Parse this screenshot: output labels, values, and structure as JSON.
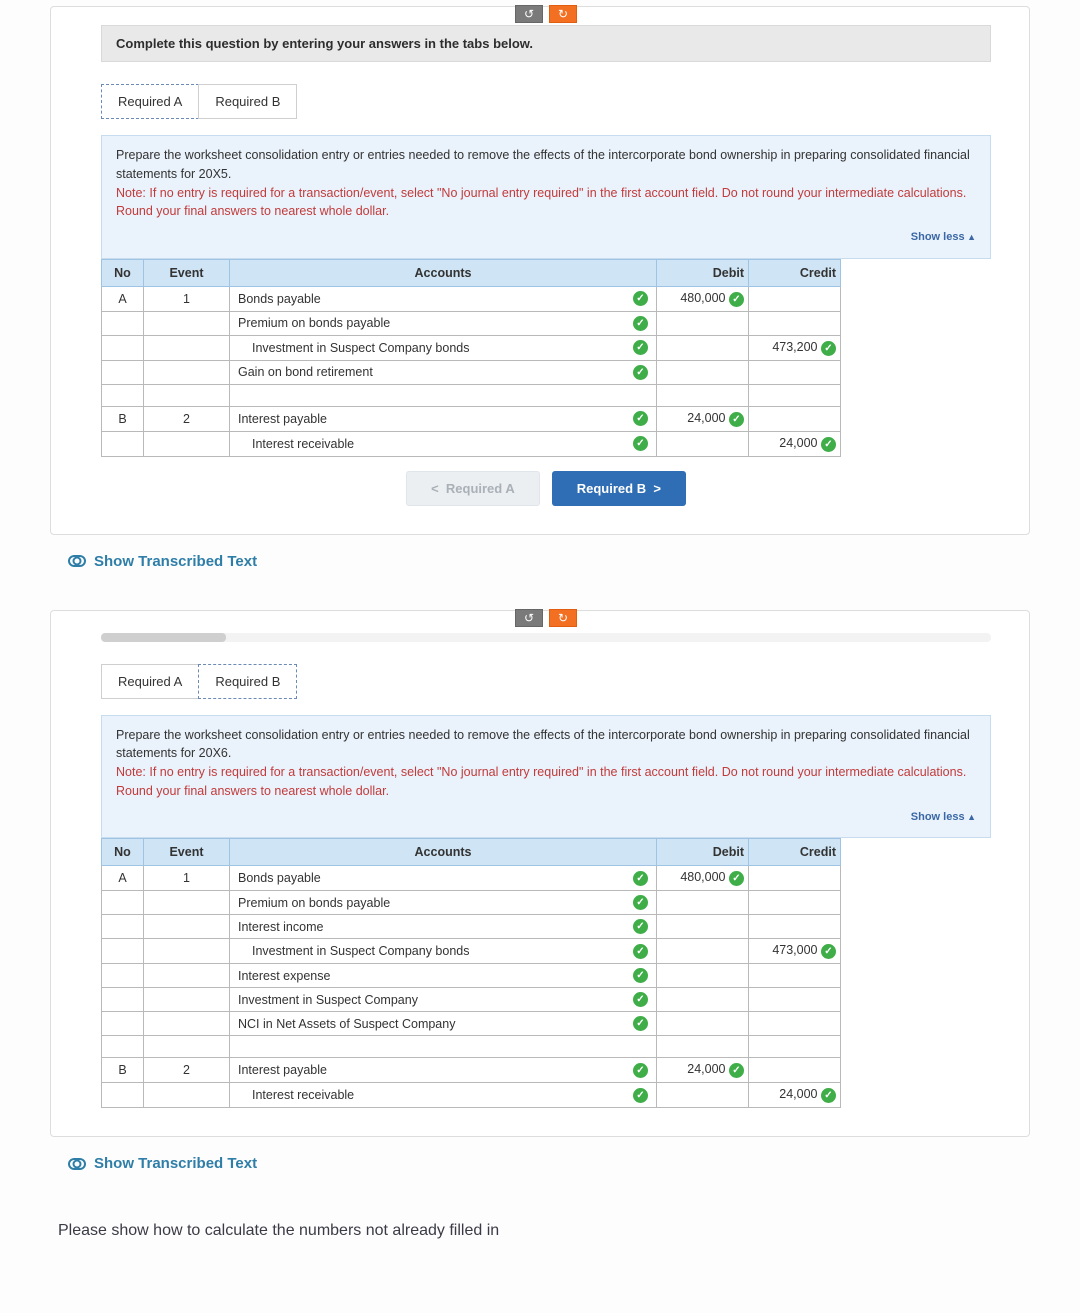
{
  "toolbar": {
    "undo_glyph": "↺",
    "redo_glyph": "↻"
  },
  "instruction": "Complete this question by entering your answers in the tabs below.",
  "tabs": {
    "a": "Required A",
    "b": "Required B"
  },
  "info1": {
    "line1": "Prepare the worksheet consolidation entry or entries needed to remove the effects of the intercorporate bond ownership in preparing consolidated financial statements for 20X5.",
    "note": "Note: If no entry is required for a transaction/event, select \"No journal entry required\" in the first account field. Do not round your intermediate calculations. Round your final answers to nearest whole dollar.",
    "showless": "Show less"
  },
  "info2": {
    "line1": "Prepare the worksheet consolidation entry or entries needed to remove the effects of the intercorporate bond ownership in preparing consolidated financial statements for 20X6.",
    "note": "Note: If no entry is required for a transaction/event, select \"No journal entry required\" in the first account field. Do not round your intermediate calculations. Round your final answers to nearest whole dollar.",
    "showless": "Show less"
  },
  "headers": {
    "no": "No",
    "event": "Event",
    "accounts": "Accounts",
    "debit": "Debit",
    "credit": "Credit"
  },
  "table1": {
    "r0": {
      "no": "A",
      "ev": "1",
      "acc": "Bonds payable",
      "debit": "480,000"
    },
    "r1": {
      "acc": "Premium on bonds payable"
    },
    "r2": {
      "acc": "Investment in Suspect Company bonds",
      "credit": "473,200"
    },
    "r3": {
      "acc": "Gain on bond retirement"
    },
    "r4": {
      "no": "B",
      "ev": "2",
      "acc": "Interest payable",
      "debit": "24,000"
    },
    "r5": {
      "acc": "Interest receivable",
      "credit": "24,000"
    }
  },
  "table2": {
    "r0": {
      "no": "A",
      "ev": "1",
      "acc": "Bonds payable",
      "debit": "480,000"
    },
    "r1": {
      "acc": "Premium on bonds payable"
    },
    "r2": {
      "acc": "Interest income"
    },
    "r3": {
      "acc": "Investment in Suspect Company bonds",
      "credit": "473,000"
    },
    "r4": {
      "acc": "Interest expense"
    },
    "r5": {
      "acc": "Investment in Suspect Company"
    },
    "r6": {
      "acc": "NCI in Net Assets of Suspect Company"
    },
    "r7": {
      "no": "B",
      "ev": "2",
      "acc": "Interest payable",
      "debit": "24,000"
    },
    "r8": {
      "acc": "Interest receivable",
      "credit": "24,000"
    }
  },
  "nav": {
    "prev": "Required A",
    "next": "Required B"
  },
  "transcript": "Show Transcribed Text",
  "footer": "Please show how to calculate the numbers not already filled in"
}
